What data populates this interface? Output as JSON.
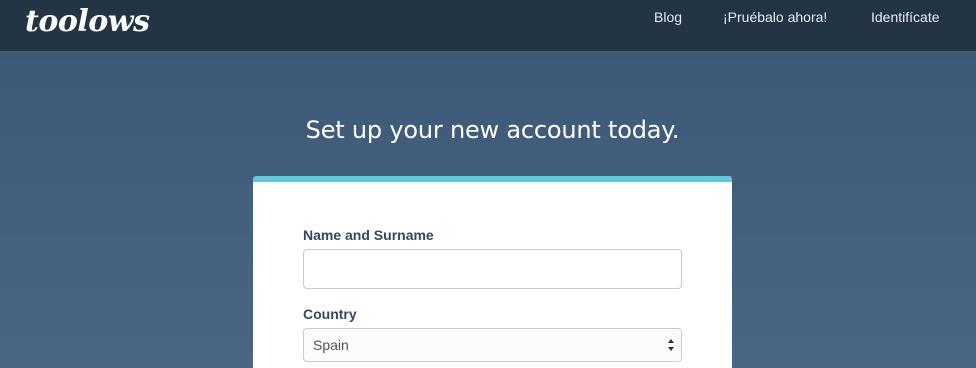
{
  "header": {
    "logo": "toolows",
    "nav": {
      "blog": "Blog",
      "try_now": "¡Pruébalo ahora!",
      "login": "Identifícate"
    }
  },
  "main": {
    "headline": "Set up your new account today."
  },
  "form": {
    "name_label": "Name and Surname",
    "name_value": "",
    "country_label": "Country",
    "country_value": "Spain"
  },
  "colors": {
    "topbar": "#233544",
    "background": "#3f5c7a",
    "card_accent": "#5fc8db",
    "label_text": "#34495e"
  }
}
